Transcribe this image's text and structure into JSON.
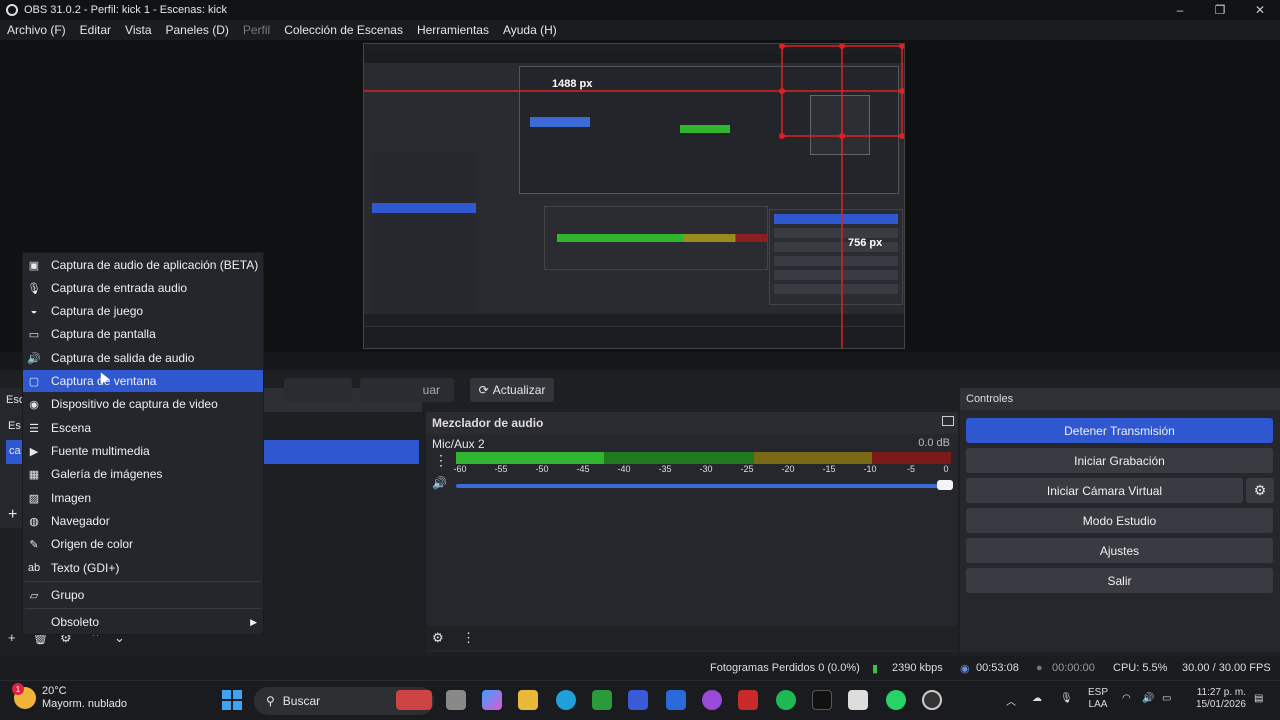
{
  "window": {
    "title": "OBS 31.0.2 - Perfil: kick 1 - Escenas: kick",
    "controls": [
      "–",
      "❐",
      "✕"
    ]
  },
  "menu": [
    "Archivo (F)",
    "Editar",
    "Vista",
    "Paneles (D)",
    "Perfil",
    "Colección de Escenas",
    "Herramientas",
    "Ayuda (H)"
  ],
  "preview": {
    "width_label": "1488 px",
    "height_label": "756 px"
  },
  "context_menu": {
    "items": [
      {
        "icon": "audio-app-icon",
        "glyph": "▣",
        "label": "Captura de audio de aplicación (BETA)"
      },
      {
        "icon": "microphone-icon",
        "glyph": "🎙",
        "label": "Captura de entrada audio"
      },
      {
        "icon": "gamepad-icon",
        "glyph": "◒",
        "label": "Captura de juego"
      },
      {
        "icon": "monitor-icon",
        "glyph": "▭",
        "label": "Captura de pantalla"
      },
      {
        "icon": "speaker-icon",
        "glyph": "🔊",
        "label": "Captura de salida de audio"
      },
      {
        "icon": "window-icon",
        "glyph": "▢",
        "label": "Captura de ventana",
        "selected": true
      },
      {
        "icon": "camera-icon",
        "glyph": "◉",
        "label": "Dispositivo de captura de video"
      },
      {
        "icon": "list-icon",
        "glyph": "☰",
        "label": "Escena"
      },
      {
        "icon": "play-icon",
        "glyph": "▶",
        "label": "Fuente multimedia"
      },
      {
        "icon": "gallery-icon",
        "glyph": "▦",
        "label": "Galería de imágenes"
      },
      {
        "icon": "image-icon",
        "glyph": "▨",
        "label": "Imagen"
      },
      {
        "icon": "globe-icon",
        "glyph": "◍",
        "label": "Navegador"
      },
      {
        "icon": "brush-icon",
        "glyph": "✎",
        "label": "Origen de color"
      },
      {
        "icon": "text-icon",
        "glyph": "ab",
        "label": "Texto (GDI+)"
      },
      {
        "icon": "folder-icon",
        "glyph": "▱",
        "label": "Grupo"
      },
      {
        "icon": "",
        "glyph": "",
        "label": "Obsoleto"
      }
    ]
  },
  "toolbar": {
    "refresh_label": "Actualizar",
    "partial_label": "uar",
    "scenes_left": [
      "Esc",
      "Es",
      "ca"
    ]
  },
  "mixer": {
    "title": "Mezclador de audio",
    "track_name": "Mic/Aux 2",
    "db_value": "0.0 dB",
    "ticks": [
      "-60",
      "-55",
      "-50",
      "-45",
      "-40",
      "-35",
      "-30",
      "-25",
      "-20",
      "-15",
      "-10",
      "-5",
      "0"
    ]
  },
  "controls": {
    "title": "Controles",
    "buttons": {
      "stop_stream": "Detener Transmisión",
      "start_recording": "Iniciar Grabación",
      "start_virtual_cam": "Iniciar Cámara Virtual",
      "studio_mode": "Modo Estudio",
      "settings": "Ajustes",
      "exit": "Salir"
    }
  },
  "statusbar": {
    "dropped_frames": "Fotogramas Perdidos 0 (0.0%)",
    "bitrate": "2390 kbps",
    "stream_time": "00:53:08",
    "record_time": "00:00:00",
    "cpu": "CPU: 5.5%",
    "fps": "30.00 / 30.00 FPS"
  },
  "taskbar": {
    "weather_temp": "20°C",
    "weather_desc": "Mayorm. nublado",
    "weather_badge": "1",
    "search_placeholder": "Buscar",
    "lang_line1": "ESP",
    "lang_line2": "LAA",
    "time": "11:27 p. m.",
    "date": "15/01/2026",
    "colors": {
      "accent": "#2f58d0",
      "meter_green": "#2fb52f"
    }
  }
}
